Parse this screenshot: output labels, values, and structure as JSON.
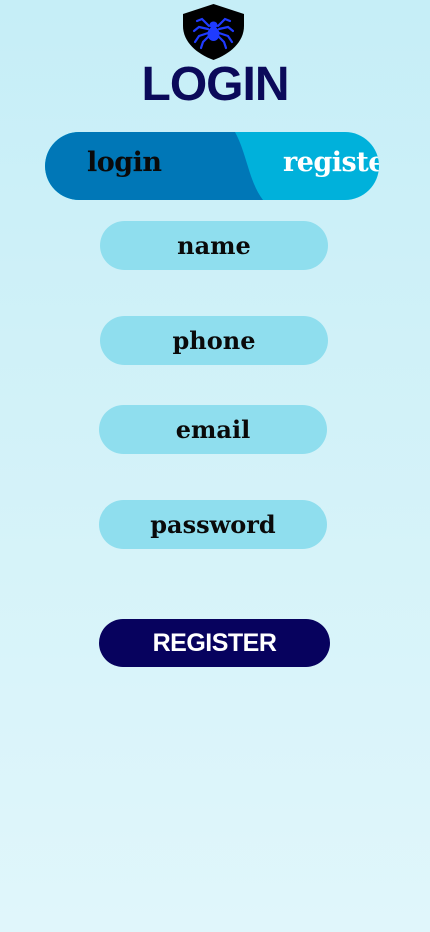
{
  "header": {
    "logo_icon": "spider-shield-icon",
    "title": "LOGIN"
  },
  "tabs": {
    "login_label": "login",
    "register_label": "register",
    "active": "register"
  },
  "form": {
    "name_placeholder": "name",
    "phone_placeholder": "phone",
    "email_placeholder": "email",
    "password_placeholder": "password",
    "submit_label": "REGISTER"
  },
  "colors": {
    "title": "#0b0a5a",
    "tab_login_bg": "#0077b7",
    "tab_register_bg": "#00b1db",
    "field_bg": "#8fdeee",
    "button_bg": "#07025e",
    "logo_spider": "#1f3bff"
  }
}
